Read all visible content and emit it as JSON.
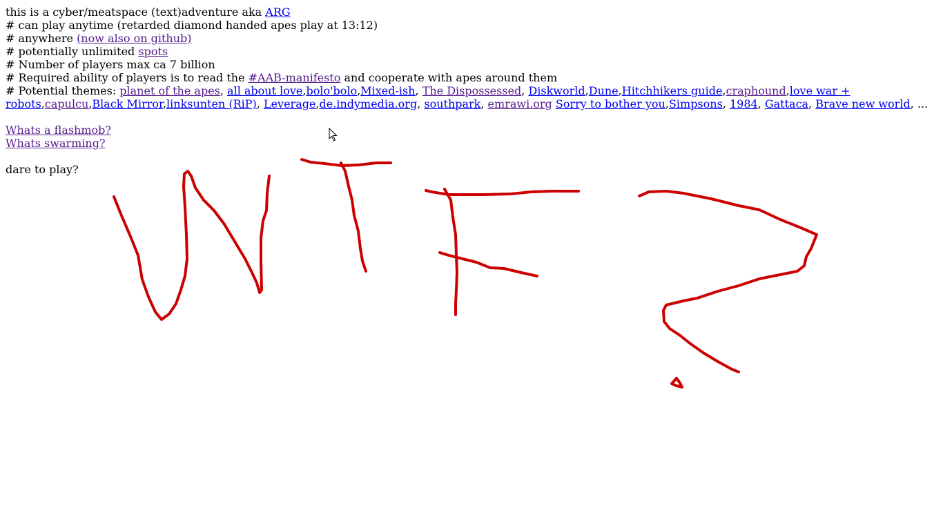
{
  "intro": {
    "text": "this is a cyber/meatspace (text)adventure aka",
    "link": "ARG"
  },
  "lines": {
    "anytime": "# can play anytime (retarded diamond handed apes play at 13:12)",
    "anywhere_prefix": "# anywhere",
    "anywhere_link": "(now also on github)",
    "spots_prefix": "# potentially unlimited",
    "spots_link": "spots",
    "players": "# Number of players max ca 7 billion",
    "required_prefix": "# Required ability of players is to read the",
    "required_link": "#AAB-manifesto",
    "required_suffix": "and cooperate with apes around them",
    "themes_prefix": "# Potential themes:"
  },
  "themes": [
    {
      "label": "planet of the apes",
      "visited": true,
      "sep": ", "
    },
    {
      "label": "all about love",
      "visited": false,
      "sep": ","
    },
    {
      "label": "bolo'bolo",
      "visited": false,
      "sep": ","
    },
    {
      "label": "Mixed-ish",
      "visited": false,
      "sep": ", "
    },
    {
      "label": "The Dispossessed",
      "visited": true,
      "sep": ", "
    },
    {
      "label": "Diskworld",
      "visited": false,
      "sep": ","
    },
    {
      "label": "Dune",
      "visited": false,
      "sep": ","
    },
    {
      "label": "Hitchhikers guide",
      "visited": false,
      "sep": ","
    },
    {
      "label": "craphound",
      "visited": true,
      "sep": ","
    },
    {
      "label": "love war + robots",
      "visited": false,
      "sep": ","
    },
    {
      "label": "capulcu",
      "visited": true,
      "sep": ","
    },
    {
      "label": "Black Mirror",
      "visited": false,
      "sep": ","
    },
    {
      "label": "linksunten (RiP)",
      "visited": false,
      "sep": ", "
    },
    {
      "label": "Leverage",
      "visited": false,
      "sep": ","
    },
    {
      "label": "de.indymedia.org",
      "visited": false,
      "sep": ", "
    },
    {
      "label": "southpark",
      "visited": false,
      "sep": ", "
    },
    {
      "label": "emrawi.org",
      "visited": true,
      "sep": " "
    },
    {
      "label": "Sorry to bother you",
      "visited": false,
      "sep": ","
    },
    {
      "label": "Simpsons",
      "visited": false,
      "sep": ", "
    },
    {
      "label": "1984",
      "visited": false,
      "sep": ", "
    },
    {
      "label": "Gattaca",
      "visited": false,
      "sep": ", "
    },
    {
      "label": "Brave new world",
      "visited": false,
      "sep": ", ..."
    }
  ],
  "links": {
    "flashmob": "Whats a flashmob?",
    "swarming": "Whats swarming?"
  },
  "dare": "dare to play?",
  "drawing": {
    "text": "WTF?",
    "stroke_color": "#cc0000"
  },
  "colors": {
    "link_unvisited": "#0000ee",
    "link_visited": "#551a8b",
    "text": "#000000",
    "background": "#ffffff"
  }
}
